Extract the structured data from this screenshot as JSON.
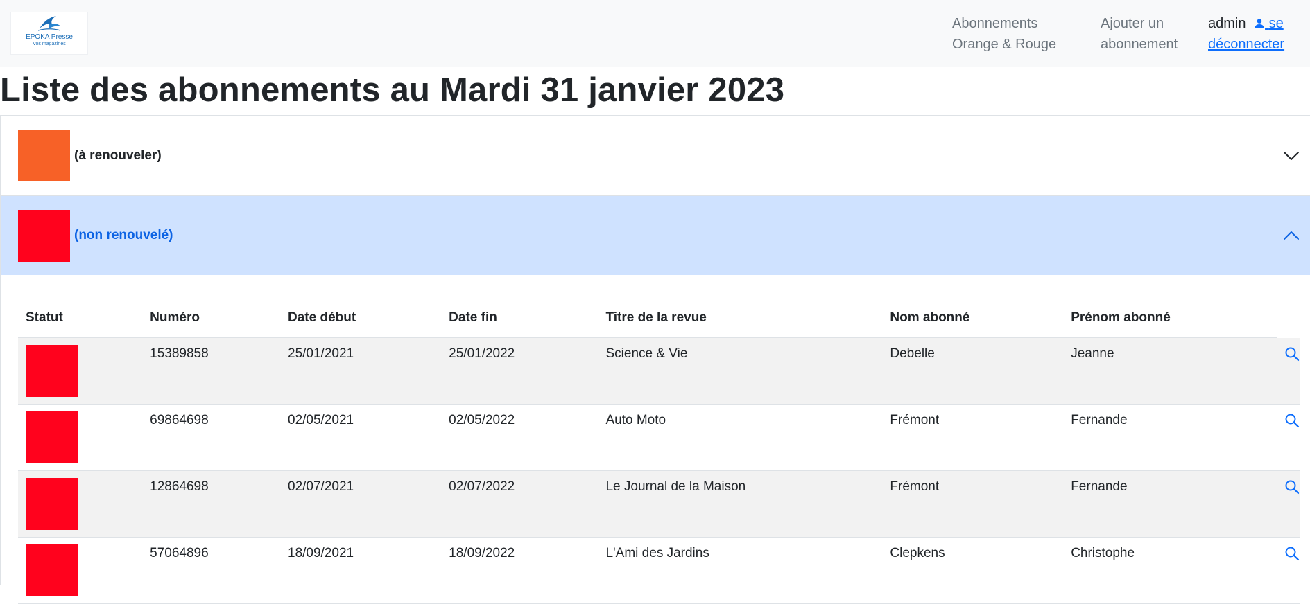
{
  "colors": {
    "orange": "#f76127",
    "red": "#ff021d",
    "open_header_bg": "#cfe2ff",
    "link_blue": "#0d6efd"
  },
  "navbar": {
    "logo": {
      "brand": "EPOKA Presse",
      "tagline": "Vos magazines",
      "icon": "bird-logo-icon"
    },
    "links": [
      {
        "line1": "Abonnements",
        "line2": "Orange & Rouge"
      },
      {
        "line1": "Ajouter un",
        "line2": "abonnement"
      }
    ],
    "user": {
      "name": "admin",
      "icon": "person-icon",
      "logout_line1": "se",
      "logout_line2": "déconnecter"
    }
  },
  "page": {
    "title": "Liste des abonnements au Mardi 31 janvier 2023"
  },
  "accordion": {
    "sections": [
      {
        "label": "(à renouveler)",
        "color": "#f76127",
        "expanded": false,
        "icon": "chevron-down-icon"
      },
      {
        "label": "(non renouvelé)",
        "color": "#ff021d",
        "expanded": true,
        "icon": "chevron-up-icon"
      }
    ]
  },
  "table": {
    "headers": [
      "Statut",
      "Numéro",
      "Date début",
      "Date fin",
      "Titre de la revue",
      "Nom abonné",
      "Prénom abonné"
    ],
    "rows": [
      {
        "status_color": "#ff021d",
        "numero": "15389858",
        "debut": "25/01/2021",
        "fin": "25/01/2022",
        "titre": "Science & Vie",
        "nom": "Debelle",
        "prenom": "Jeanne",
        "action_icon": "search-icon"
      },
      {
        "status_color": "#ff021d",
        "numero": "69864698",
        "debut": "02/05/2021",
        "fin": "02/05/2022",
        "titre": "Auto Moto",
        "nom": "Frémont",
        "prenom": "Fernande",
        "action_icon": "search-icon"
      },
      {
        "status_color": "#ff021d",
        "numero": "12864698",
        "debut": "02/07/2021",
        "fin": "02/07/2022",
        "titre": "Le Journal de la Maison",
        "nom": "Frémont",
        "prenom": "Fernande",
        "action_icon": "search-icon"
      },
      {
        "status_color": "#ff021d",
        "numero": "57064896",
        "debut": "18/09/2021",
        "fin": "18/09/2022",
        "titre": "L'Ami des Jardins",
        "nom": "Clepkens",
        "prenom": "Christophe",
        "action_icon": "search-icon"
      }
    ]
  }
}
